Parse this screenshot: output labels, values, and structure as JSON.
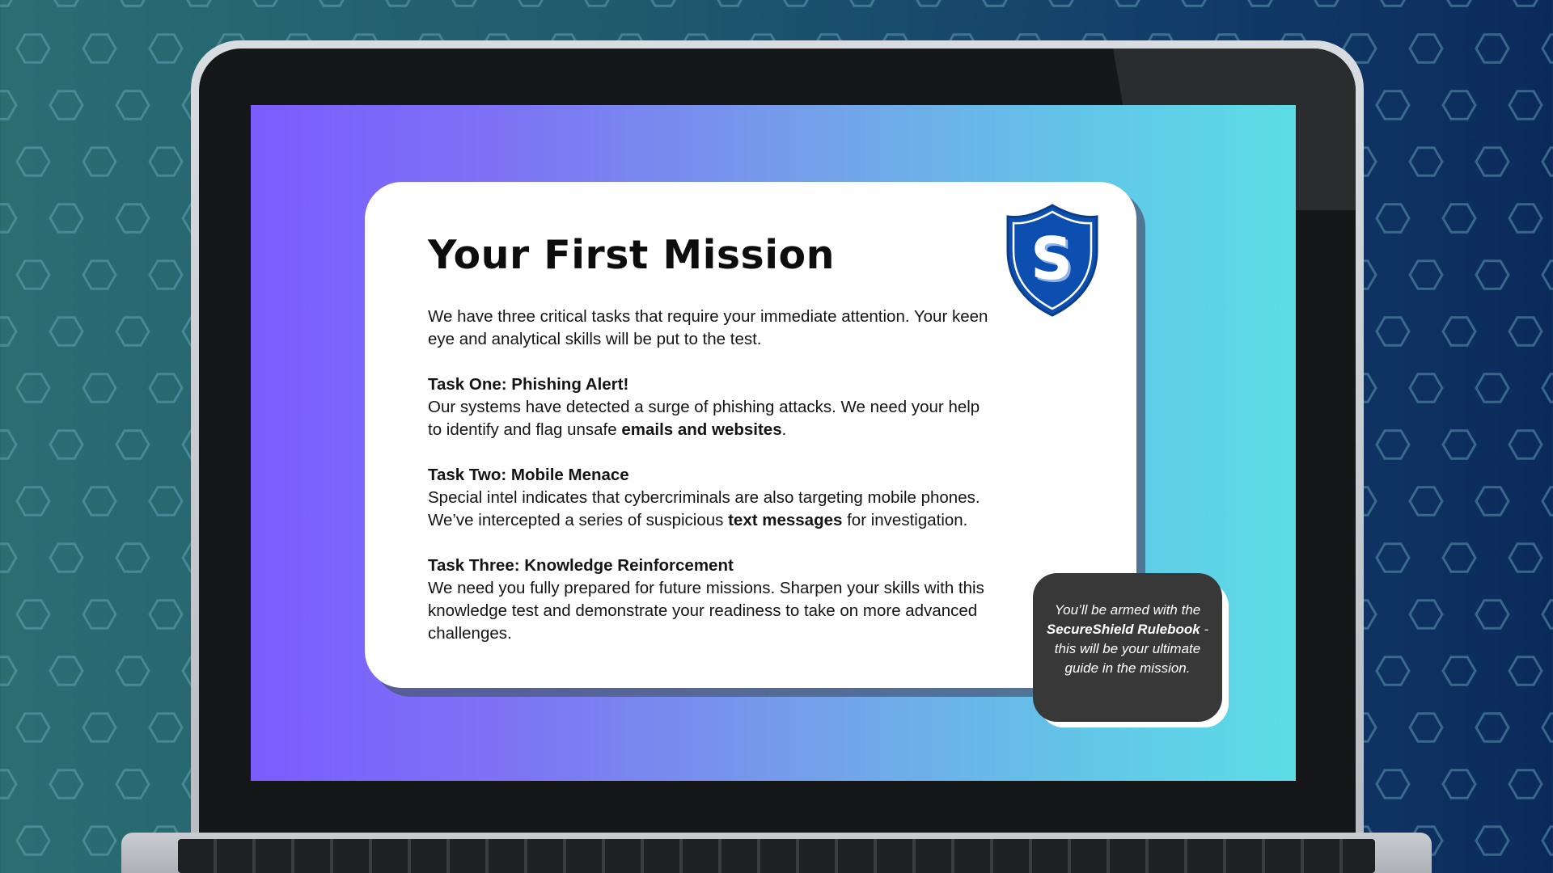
{
  "colors": {
    "screen_gradient_start": "#7b5cff",
    "screen_gradient_end": "#5cdde6",
    "card_background": "#ffffff",
    "tooltip_background": "#383838",
    "shield_blue": "#0d4fb0"
  },
  "logo": {
    "letter": "S"
  },
  "mission": {
    "title": "Your First Mission",
    "intro": "We have three critical tasks that require your immediate attention. Your keen eye and analytical skills will be put to the test.",
    "tasks": [
      {
        "title": "Task One: Phishing Alert!",
        "text_before": "Our systems have detected a surge of phishing attacks. We need your help to identify and flag unsafe ",
        "highlight": "emails and websites",
        "text_after": "."
      },
      {
        "title": "Task Two: Mobile Menace",
        "text_before": "Special intel indicates that cybercriminals are also targeting mobile phones. We’ve intercepted a series of suspicious ",
        "highlight": "text messages",
        "text_after": " for investigation."
      },
      {
        "title": "Task Three: Knowledge Reinforcement",
        "text": "We need you fully prepared for future missions. Sharpen your skills with this knowledge test and demonstrate your readiness to take on more advanced challenges."
      }
    ]
  },
  "tooltip": {
    "text_before": "You’ll be armed with the ",
    "highlight": "SecureShield Rulebook",
    "text_after": " - this  will be your ultimate guide  in the mission."
  }
}
